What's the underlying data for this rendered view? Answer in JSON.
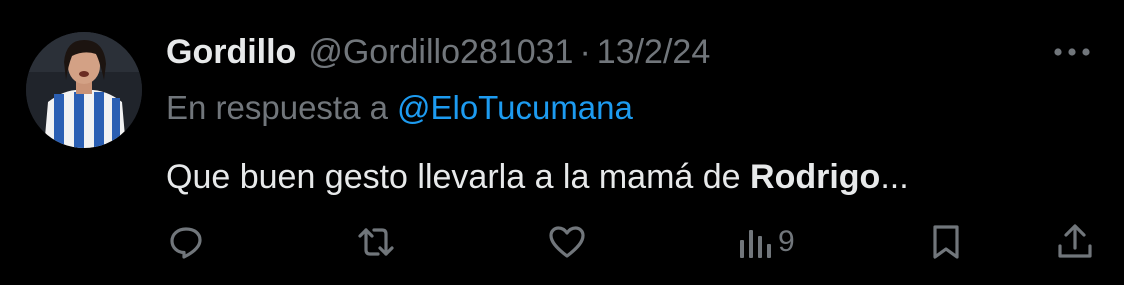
{
  "tweet": {
    "display_name": "Gordillo",
    "handle": "@Gordillo281031",
    "separator": "·",
    "date": "13/2/24",
    "reply_prefix": "En respuesta a",
    "reply_mention": "@EloTucumana",
    "text_prefix": "Que buen gesto llevarla a la mamá de ",
    "text_bold": "Rodrigo",
    "text_suffix": "...",
    "views": "9"
  },
  "icons": {
    "more": "more-dots-icon",
    "reply": "reply-icon",
    "retweet": "retweet-icon",
    "like": "heart-icon",
    "views": "views-icon",
    "bookmark": "bookmark-icon",
    "share": "share-icon"
  },
  "colors": {
    "background": "#000000",
    "primary_text": "#e7e9ea",
    "secondary_text": "#71767b",
    "link": "#1d9bf0"
  }
}
